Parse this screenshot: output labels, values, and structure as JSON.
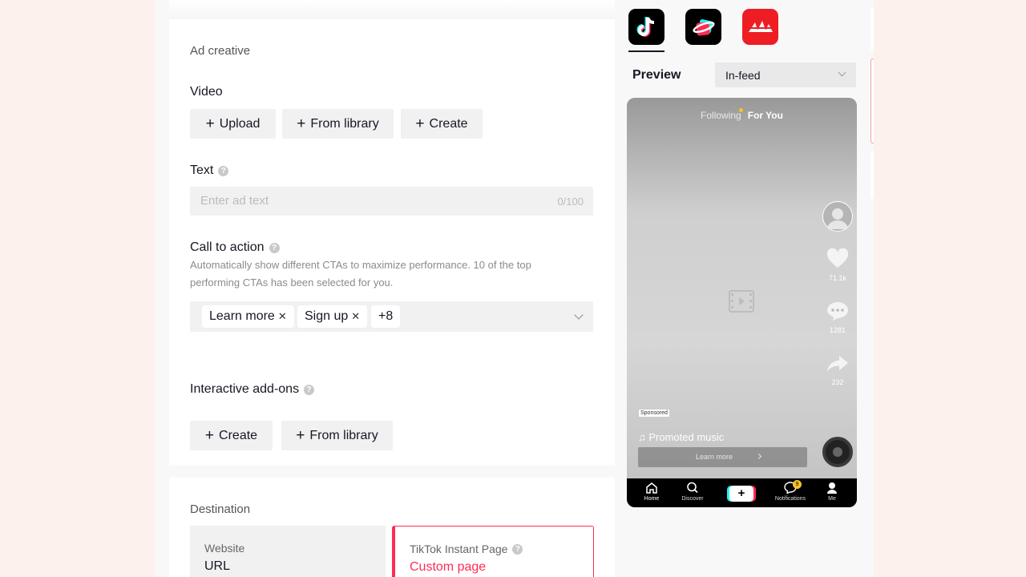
{
  "ad_creative": {
    "section_title": "Ad creative",
    "video": {
      "label": "Video",
      "upload": "Upload",
      "from_library": "From library",
      "create": "Create"
    },
    "text": {
      "label": "Text",
      "placeholder": "Enter ad text",
      "counter": "0/100"
    },
    "cta": {
      "label": "Call to action",
      "description": "Automatically show different CTAs to maximize performance. 10 of the top performing CTAs has been selected for you.",
      "tags": [
        "Learn more",
        "Sign up"
      ],
      "more": "+8"
    }
  },
  "interactive": {
    "label": "Interactive add-ons",
    "create": "Create",
    "from_library": "From library"
  },
  "destination": {
    "section_title": "Destination",
    "website": {
      "label": "Website",
      "value": "URL"
    },
    "instant_page": {
      "label": "TikTok Instant Page",
      "value": "Custom page"
    }
  },
  "preview": {
    "label": "Preview",
    "placement": "In-feed",
    "apps": [
      "tiktok-app-icon",
      "lite-app-icon",
      "pangle-app-icon"
    ],
    "phone": {
      "tab_following": "Following",
      "tab_for_you": "For You",
      "likes": "71.1k",
      "comments": "1281",
      "shares": "232",
      "sponsored": "Sponsored",
      "music": "♫ Promoted music",
      "cta_button": "Learn more",
      "nav": [
        "Home",
        "Discover",
        "Notifications",
        "Me"
      ],
      "notification_count": "9"
    }
  },
  "colors": {
    "accent": "#fe2c55",
    "bg": "#fdf1ee",
    "input_bg": "#f1f1f2"
  }
}
